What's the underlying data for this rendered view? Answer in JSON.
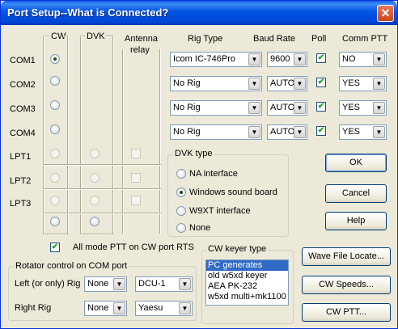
{
  "window": {
    "title": "Port Setup--What is Connected?",
    "close_glyph": "✕"
  },
  "headers": {
    "cw": "CW",
    "dvk": "DVK",
    "antenna_relay_1": "Antenna",
    "antenna_relay_2": "relay",
    "rig_type": "Rig Type",
    "baud_rate": "Baud Rate",
    "poll": "Poll",
    "comm_ptt": "Comm PTT"
  },
  "com_ports": [
    {
      "label": "COM1",
      "cw_checked": true,
      "rig": "Icom IC-746Pro",
      "baud": "9600",
      "poll": true,
      "ptt": "NO"
    },
    {
      "label": "COM2",
      "cw_checked": false,
      "rig": "No Rig",
      "baud": "AUTO",
      "poll": true,
      "ptt": "YES"
    },
    {
      "label": "COM3",
      "cw_checked": false,
      "rig": "No Rig",
      "baud": "AUTO",
      "poll": true,
      "ptt": "YES"
    },
    {
      "label": "COM4",
      "cw_checked": false,
      "rig": "No Rig",
      "baud": "AUTO",
      "poll": true,
      "ptt": "YES"
    }
  ],
  "lpt_ports": [
    {
      "label": "LPT1"
    },
    {
      "label": "LPT2"
    },
    {
      "label": "LPT3"
    }
  ],
  "dvk_type": {
    "title": "DVK type",
    "options": [
      {
        "label": "NA interface",
        "checked": false
      },
      {
        "label": "Windows sound board",
        "checked": true
      },
      {
        "label": "W9XT interface",
        "checked": false
      },
      {
        "label": "None",
        "checked": false
      }
    ]
  },
  "all_mode_ptt": {
    "label": "All mode PTT on CW port RTS",
    "checked": true
  },
  "rotator": {
    "title": "Rotator control on COM port",
    "left_label": "Left (or only) Rig",
    "left_port": "None",
    "left_type": "DCU-1",
    "right_label": "Right Rig",
    "right_port": "None",
    "right_type": "Yaesu"
  },
  "cw_keyer": {
    "title": "CW keyer type",
    "items": [
      "PC generates",
      "old w5xd keyer",
      "AEA PK-232",
      "w5xd multi+mk1100"
    ],
    "selected_index": 0
  },
  "buttons": {
    "ok": "OK",
    "cancel": "Cancel",
    "help": "Help",
    "wave_file": "Wave File Locate...",
    "cw_speeds": "CW Speeds...",
    "cw_ptt": "CW PTT..."
  },
  "glyphs": {
    "arrow": "▼",
    "check": "✔"
  }
}
